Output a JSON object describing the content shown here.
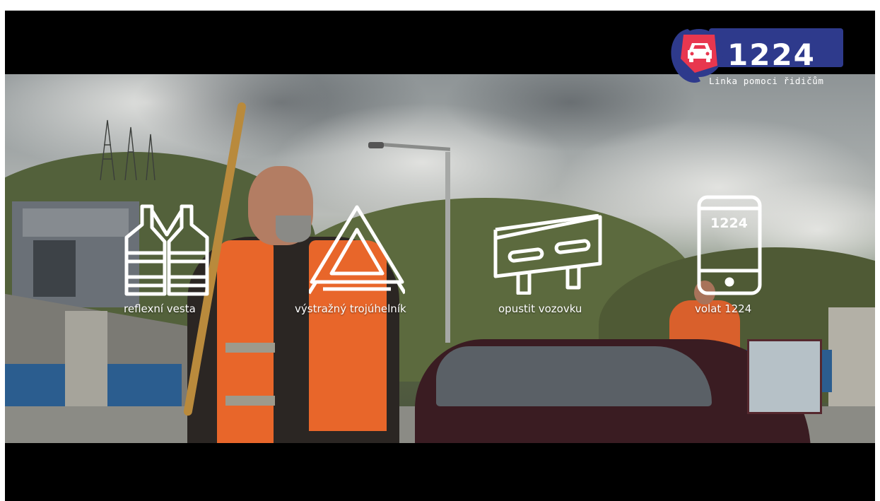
{
  "video": {
    "logo": {
      "number": "1224",
      "tagline": "Linka pomoci řidičům",
      "icon": "car-phone-icon",
      "colors": {
        "badge": "#2e3a8c",
        "accent": "#e8374f"
      }
    },
    "steps": [
      {
        "label": "reflexní vesta",
        "icon": "reflective-vest-icon"
      },
      {
        "label": "výstražný trojúhelník",
        "icon": "warning-triangle-icon"
      },
      {
        "label": "opustit vozovku",
        "icon": "road-barrier-icon"
      },
      {
        "label": "volat 1224",
        "icon": "phone-icon",
        "screen_text": "1224"
      }
    ]
  }
}
